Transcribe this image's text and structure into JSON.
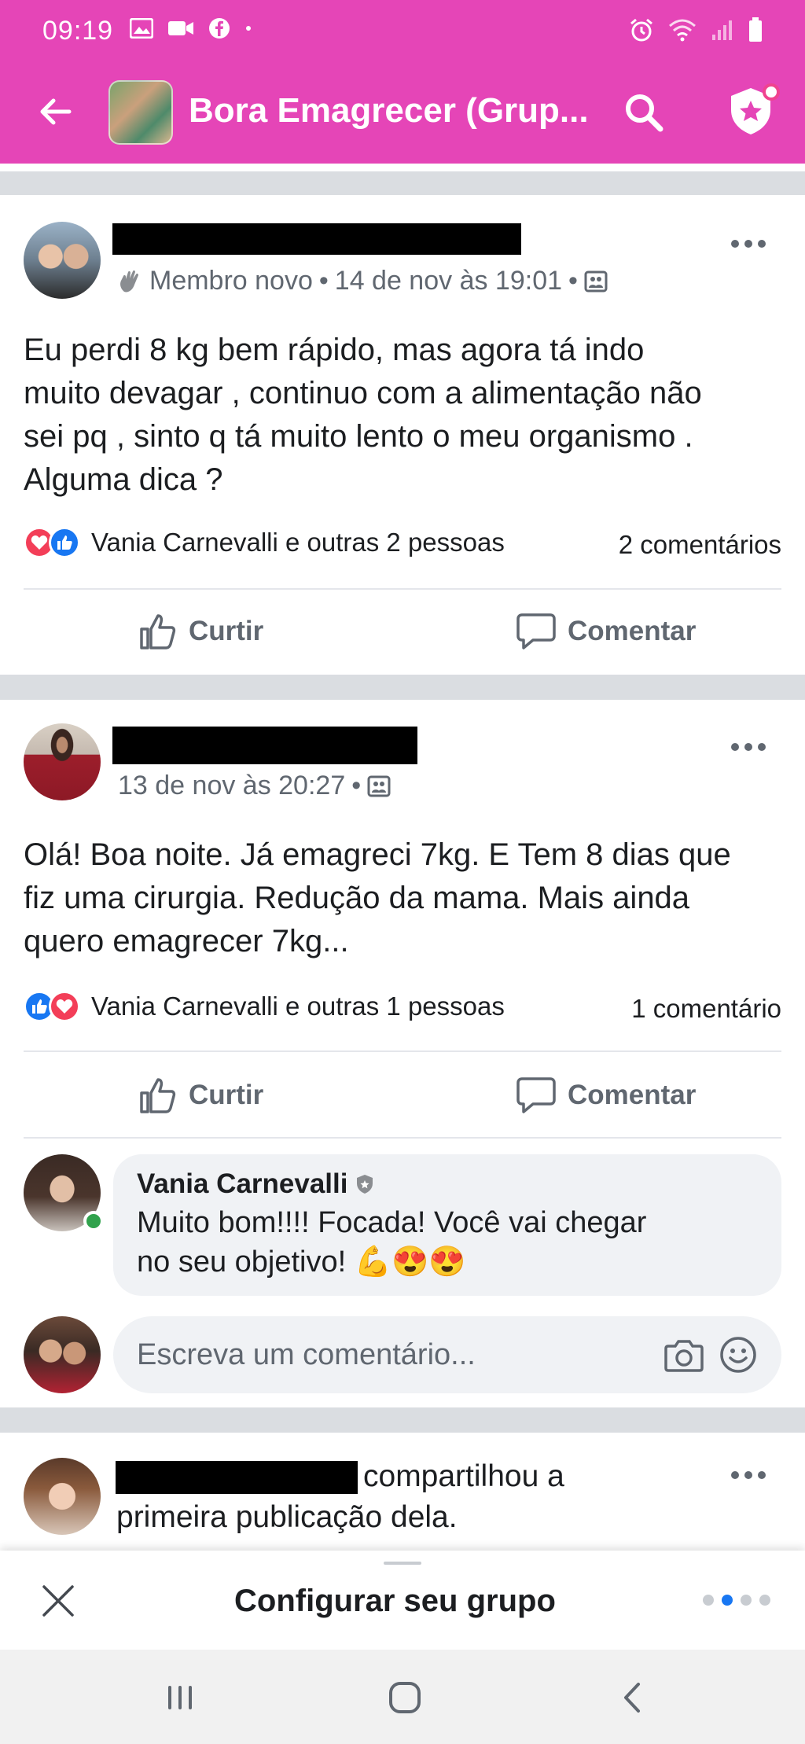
{
  "status_bar": {
    "time": "09:19"
  },
  "app_bar": {
    "title": "Bora Emagrecer (Grup..."
  },
  "posts": [
    {
      "meta_badge": "Membro novo",
      "meta_time": "14 de nov às 19:01",
      "text_lines": [
        "Eu perdi 8 kg bem rápido,  mas agora tá indo",
        "muito devagar , continuo com a alimentação não",
        "sei pq , sinto  q tá muito lento o meu organismo .",
        "Alguma dica ?"
      ],
      "reactions_text": "Vania Carnevalli e outras 2 pessoas",
      "comments_count": "2 comentários",
      "like_label": "Curtir",
      "comment_label": "Comentar"
    },
    {
      "meta_time": "13 de nov às 20:27",
      "text_lines": [
        "Olá! Boa noite. Já emagreci 7kg. E Tem 8 dias que",
        "fiz uma cirurgia. Redução da mama. Mais ainda",
        "quero emagrecer 7kg..."
      ],
      "reactions_text": "Vania Carnevalli e outras 1 pessoas",
      "comments_count": "1 comentário",
      "like_label": "Curtir",
      "comment_label": "Comentar",
      "comment": {
        "author": "Vania Carnevalli",
        "text_line1": "Muito bom!!!! Focada! Você vai chegar",
        "text_line2": "no seu objetivo! 💪😍😍"
      },
      "write_placeholder": "Escreva um comentário..."
    },
    {
      "shared_line1": "compartilhou a",
      "shared_line2": "primeira publicação dela."
    }
  ],
  "bottom_sheet": {
    "title": "Configurar seu grupo",
    "page_dots": 4,
    "active_dot": 1
  },
  "colors": {
    "brand": "#e545b7",
    "like": "#1877f2",
    "love": "#f33e58",
    "online": "#31a24c"
  }
}
